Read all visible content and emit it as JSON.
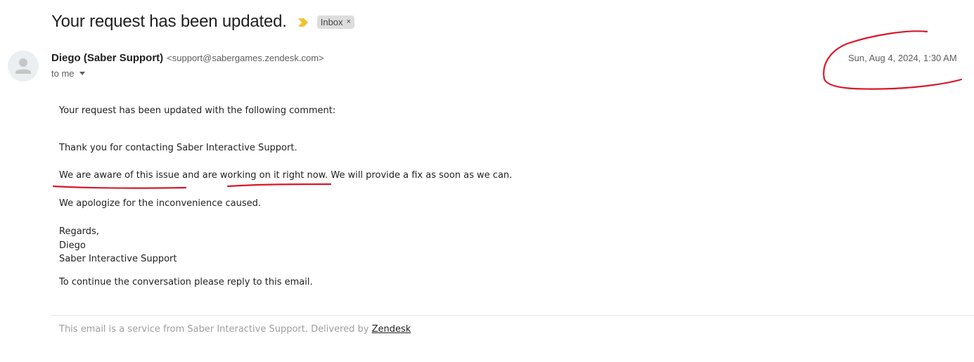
{
  "header": {
    "subject": "Your request has been updated.",
    "label_chip": "Inbox",
    "label_close": "×"
  },
  "sender": {
    "name": "Diego (Saber Support)",
    "email": "<support@sabergames.zendesk.com>",
    "to": "to me",
    "date": "Sun, Aug 4, 2024, 1:30 AM"
  },
  "body": {
    "line1": "Your request has been updated with the following comment:",
    "line2": "Thank you for contacting Saber Interactive Support.",
    "line3": "We are aware of this issue and are working on it right now. We will provide a fix as soon as we can.",
    "line4": "We apologize for the inconvenience caused.",
    "line5": "Regards,",
    "line6": "Diego",
    "line7": "Saber Interactive Support",
    "line8": "To continue the conversation please reply to this email."
  },
  "footer": {
    "text": "This email is a service from Saber Interactive Support. Delivered by ",
    "link": "Zendesk"
  },
  "colors": {
    "importance_marker": "#f2c232",
    "annotation_red": "#d9182b"
  },
  "icons": {
    "importance": "importance-marker-icon",
    "avatar": "person-avatar-icon",
    "caret": "chevron-down-icon"
  }
}
